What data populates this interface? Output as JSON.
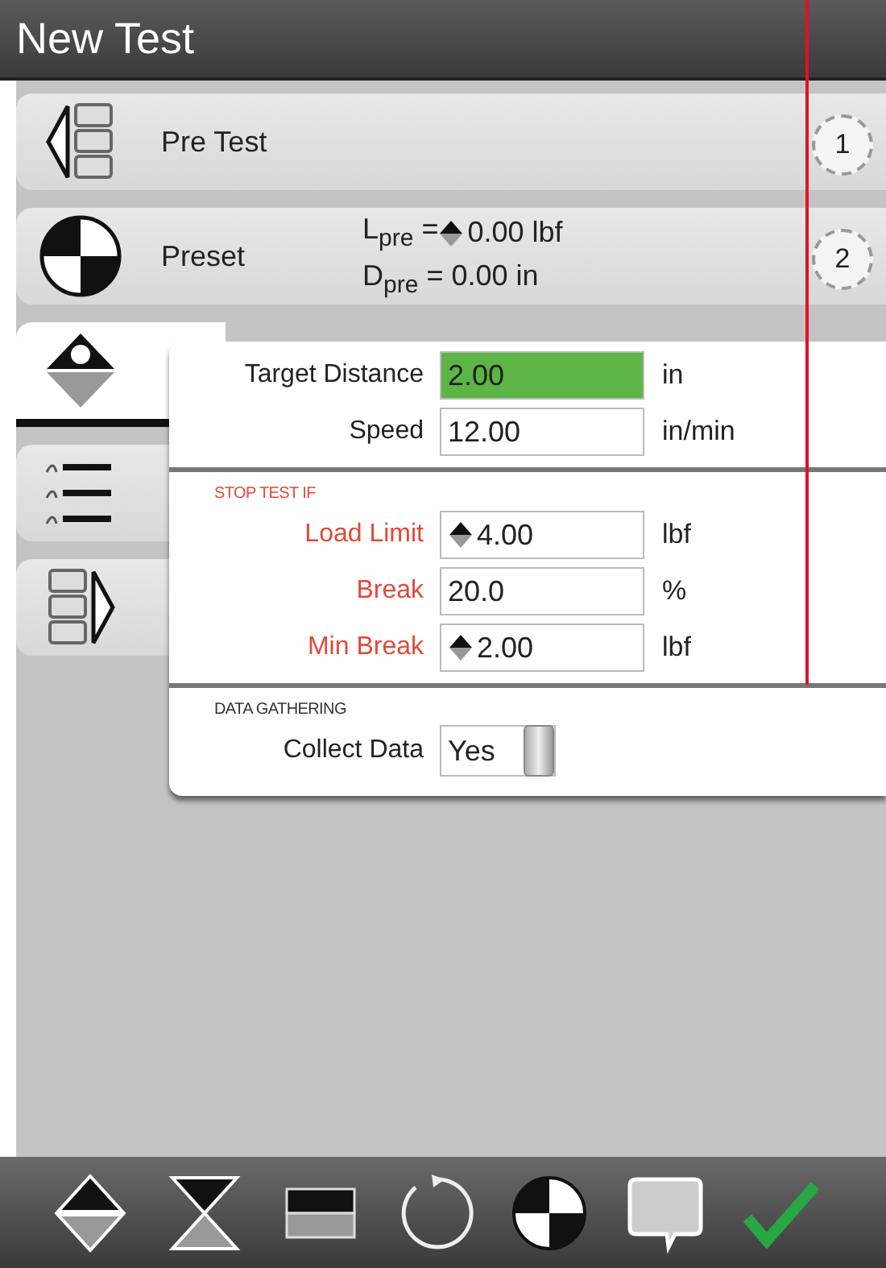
{
  "window": {
    "title": "New Test"
  },
  "steps": [
    {
      "kind": "pretest",
      "label": "Pre Test",
      "number": "1",
      "selected": false
    },
    {
      "kind": "preset",
      "label": "Preset",
      "details": [
        "L$_{pre}$ = ",
        "D$_{pre}$ = 0.00 in"
      ],
      "detail_value": "0.00 lbf",
      "number": "2",
      "selected": false
    },
    {
      "kind": "distance",
      "selected": true
    },
    {
      "kind": "data",
      "selected": false
    },
    {
      "kind": "posttest",
      "selected": false
    }
  ],
  "popup": {
    "sections": [
      {
        "kind": "plain",
        "fields": [
          {
            "label": "Target Distance",
            "value": "2.00",
            "unit": "in",
            "selected": true
          },
          {
            "label": "Speed",
            "value": "12.00",
            "unit": "in/min",
            "selected": false
          }
        ]
      },
      {
        "kind": "alert",
        "heading": "STOP TEST IF",
        "fields": [
          {
            "label": "Load Limit",
            "value": "4.00",
            "unit": "lbf",
            "selected": false,
            "stepper": true
          },
          {
            "label": "Break",
            "value": "20.0",
            "unit": "%",
            "selected": false
          },
          {
            "label": "Min Break",
            "value": "2.00",
            "unit": "lbf",
            "selected": false,
            "stepper": true
          }
        ]
      },
      {
        "kind": "plain",
        "heading": "DATA GATHERING",
        "fields": [
          {
            "label": "Collect Data",
            "value": "Yes",
            "kind": "toggle",
            "on": true,
            "selected": false
          }
        ]
      }
    ]
  },
  "toolbar": [
    {
      "kind": "updown"
    },
    {
      "kind": "hourglass"
    },
    {
      "kind": "block"
    },
    {
      "kind": "cycle"
    },
    {
      "kind": "target"
    },
    {
      "kind": "comment"
    },
    {
      "kind": "check"
    }
  ]
}
